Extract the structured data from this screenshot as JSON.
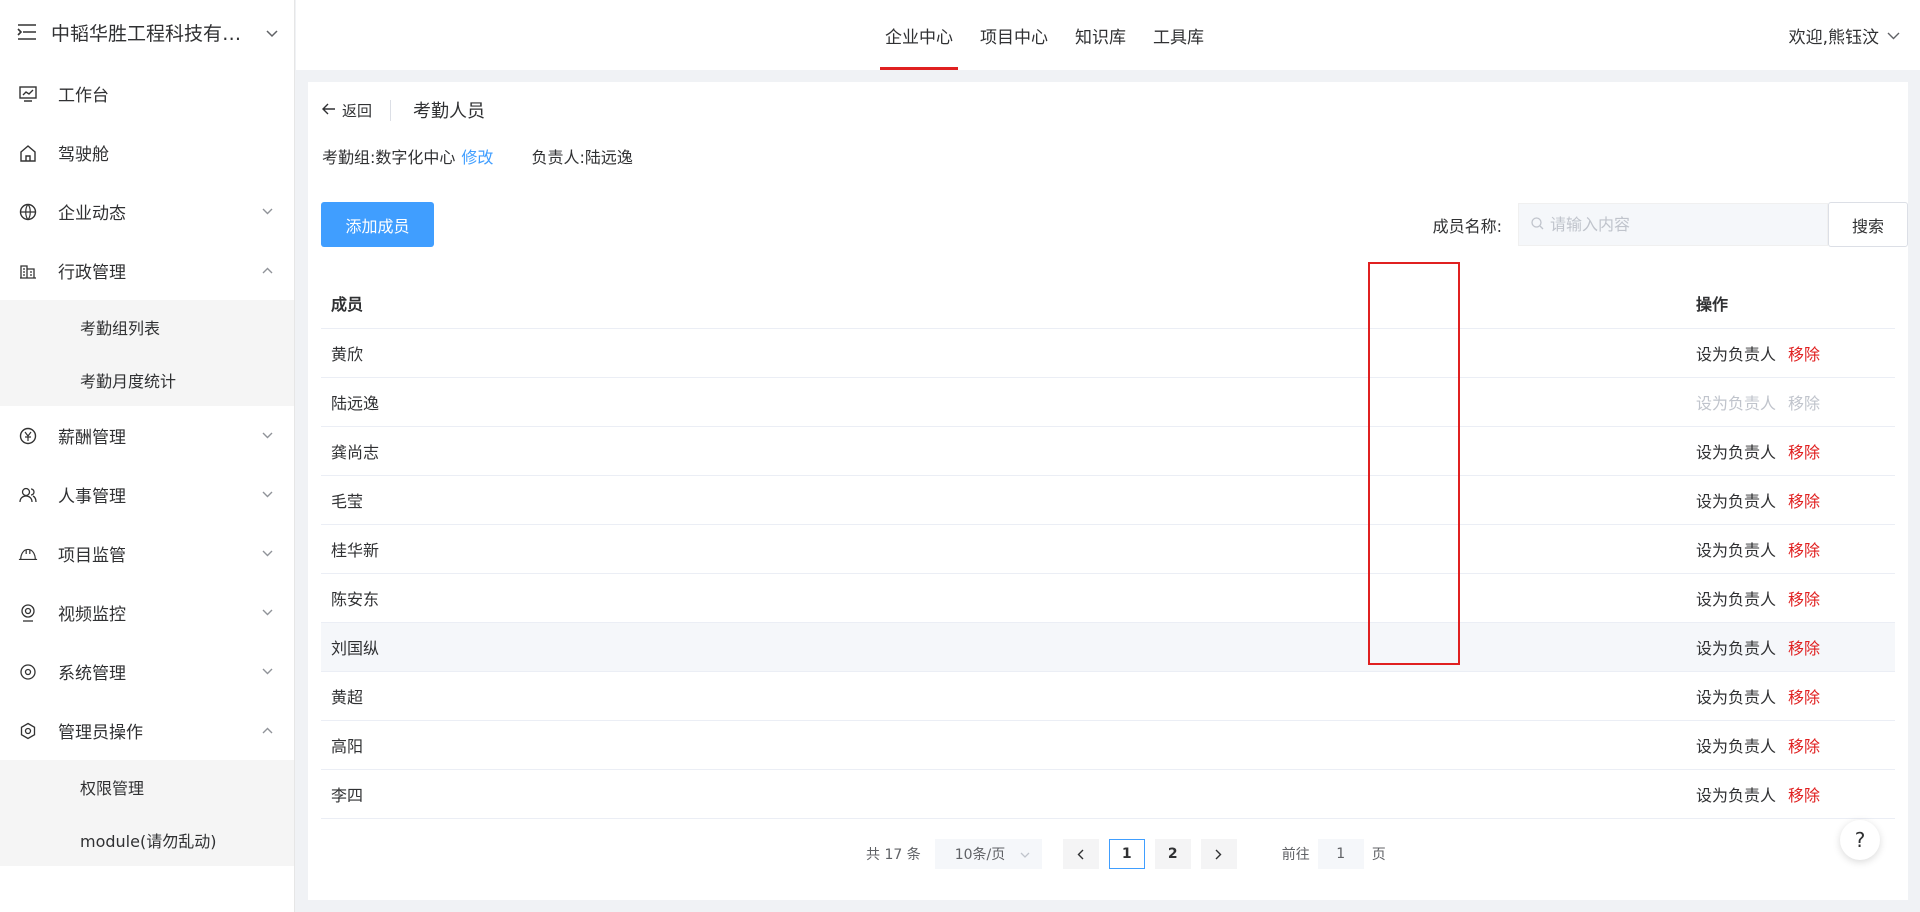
{
  "sidebar": {
    "brand": "中韬华胜工程科技有限...",
    "items": [
      {
        "label": "工作台",
        "icon": "monitor-chart-icon"
      },
      {
        "label": "驾驶舱",
        "icon": "home-icon"
      },
      {
        "label": "企业动态",
        "icon": "globe-icon"
      },
      {
        "label": "行政管理",
        "icon": "building-icon"
      },
      {
        "label": "薪酬管理",
        "icon": "yen-icon"
      },
      {
        "label": "人事管理",
        "icon": "users-icon"
      },
      {
        "label": "项目监管",
        "icon": "helmet-icon"
      },
      {
        "label": "视频监控",
        "icon": "camera-icon"
      },
      {
        "label": "系统管理",
        "icon": "settings-icon"
      },
      {
        "label": "管理员操作",
        "icon": "admin-settings-icon"
      }
    ],
    "admin_sub": [
      "考勤组列表",
      "考勤月度统计"
    ],
    "manager_sub": [
      "权限管理",
      "module(请勿乱动)"
    ]
  },
  "topbar": {
    "tabs": [
      "企业中心",
      "项目中心",
      "知识库",
      "工具库"
    ],
    "welcome": "欢迎,熊钰汶"
  },
  "page": {
    "back": "返回",
    "title": "考勤人员",
    "group_label": "考勤组:",
    "group_name": "数字化中心",
    "edit": "修改",
    "owner_label": "负责人:",
    "owner_name": "陆远逸",
    "add_member": "添加成员",
    "search_label": "成员名称:",
    "search_placeholder": "请输入内容",
    "search_button": "搜索"
  },
  "table": {
    "col_member": "成员",
    "col_action": "操作",
    "action_set": "设为负责人",
    "action_remove": "移除",
    "rows": [
      "黄欣",
      "陆远逸",
      "龚尚志",
      "毛莹",
      "桂华新",
      "陈安东",
      "刘国纵",
      "黄超",
      "高阳",
      "李四"
    ]
  },
  "pagination": {
    "total": "共 17 条",
    "page_size": "10条/页",
    "pages": [
      "1",
      "2"
    ],
    "goto_label": "前往",
    "goto_value": "1",
    "page_suffix": "页"
  },
  "help": "?",
  "colors": {
    "primary": "#409eff",
    "danger": "#e02020"
  }
}
